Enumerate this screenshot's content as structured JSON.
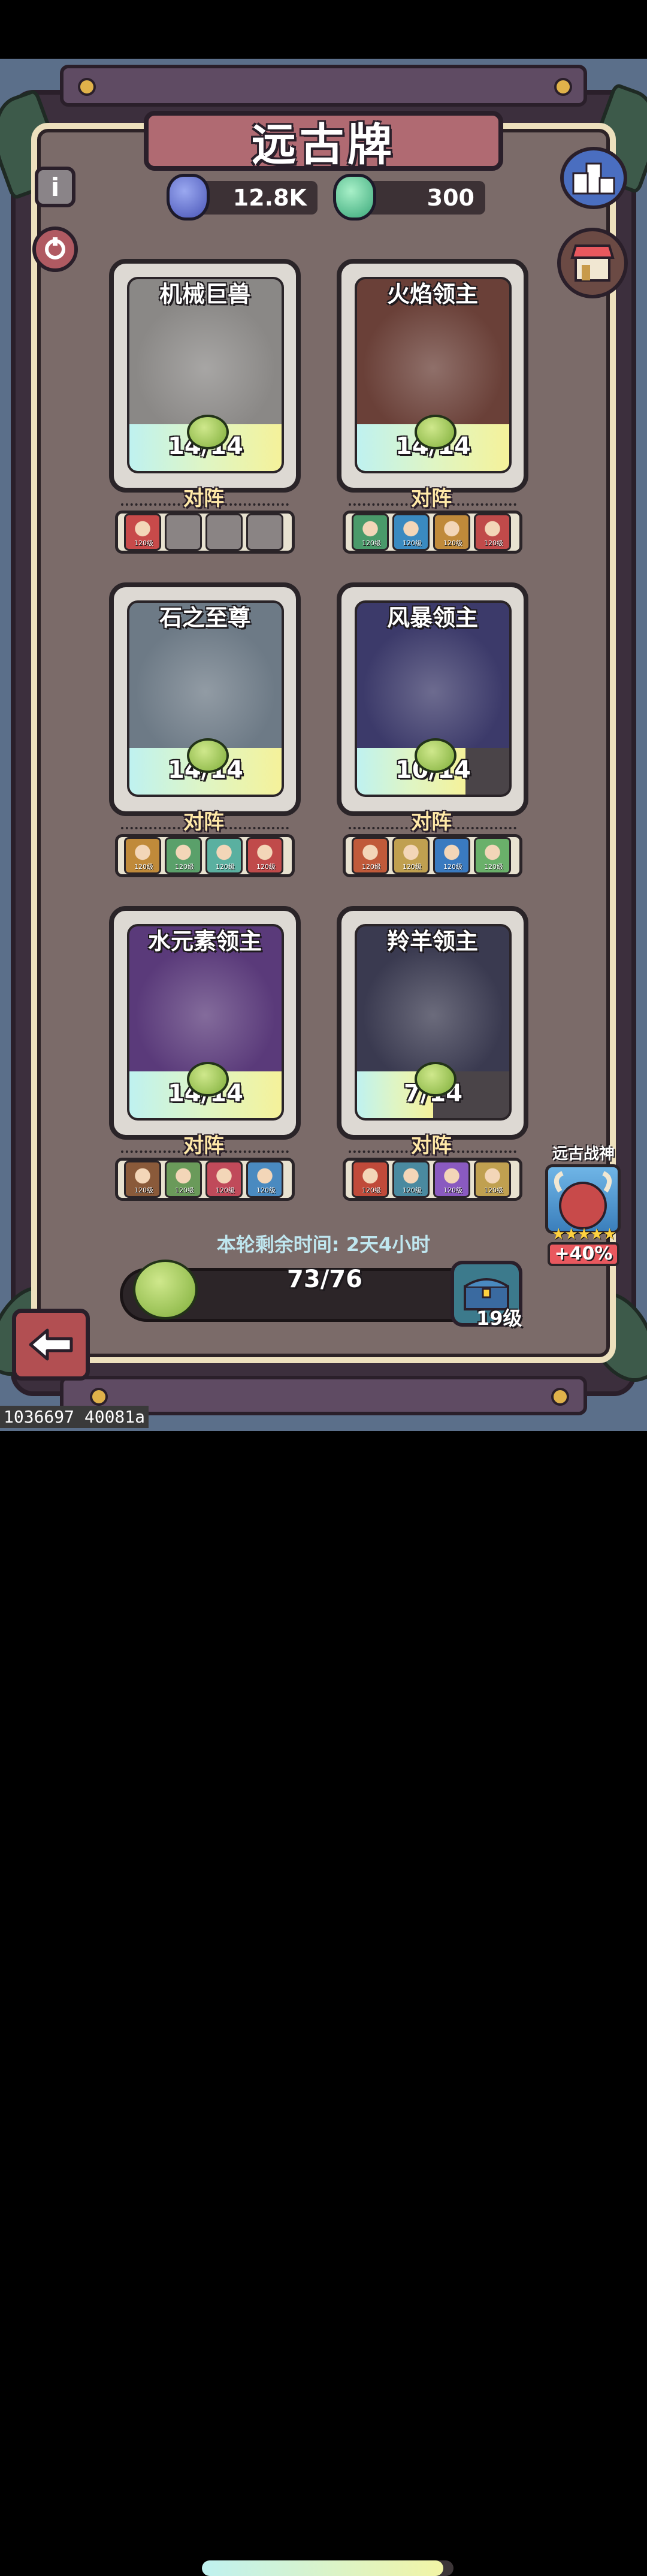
{
  "title": "远古牌",
  "resources": [
    {
      "icon": "blue-crystal-icon",
      "value": "12.8K"
    },
    {
      "icon": "green-crystal-icon",
      "value": "300"
    }
  ],
  "side_buttons": {
    "info": "i",
    "ranking_icon": "podium-icon",
    "shop_icon": "shop-icon",
    "history_icon": "refresh-icon"
  },
  "vs_label": "对阵",
  "cards": [
    {
      "name": "机械巨兽",
      "progress": "14/14",
      "filled": 14,
      "total": 14,
      "theme": "#8a8886",
      "opponents": [
        {
          "color": "#c84a4a",
          "level": "120级"
        },
        null,
        null,
        null
      ]
    },
    {
      "name": "火焰领主",
      "progress": "14/14",
      "filled": 14,
      "total": 14,
      "theme": "#6a4038",
      "opponents": [
        {
          "color": "#4a9a6a",
          "level": "120级"
        },
        {
          "color": "#3a8ac0",
          "level": "120级"
        },
        {
          "color": "#c08a3a",
          "level": "120级"
        },
        {
          "color": "#c04a4a",
          "level": "120级"
        }
      ]
    },
    {
      "name": "石之至尊",
      "progress": "14/14",
      "filled": 14,
      "total": 14,
      "theme": "#6d7a86",
      "opponents": [
        {
          "color": "#c08a3a",
          "level": "120级"
        },
        {
          "color": "#5aa06a",
          "level": "120级"
        },
        {
          "color": "#5ab0a0",
          "level": "120级"
        },
        {
          "color": "#c04a4a",
          "level": "120级"
        }
      ]
    },
    {
      "name": "风暴领主",
      "progress": "10/14",
      "filled": 10,
      "total": 14,
      "theme": "#3c3a6a",
      "opponents": [
        {
          "color": "#c05a3a",
          "level": "120级"
        },
        {
          "color": "#c0a050",
          "level": "120级"
        },
        {
          "color": "#3a7ac0",
          "level": "120级"
        },
        {
          "color": "#6ab06a",
          "level": "120级"
        }
      ]
    },
    {
      "name": "水元素领主",
      "progress": "14/14",
      "filled": 14,
      "total": 14,
      "theme": "#5a3a7a",
      "opponents": [
        {
          "color": "#8a5a3a",
          "level": "120级"
        },
        {
          "color": "#6a9a5a",
          "level": "120级"
        },
        {
          "color": "#c04a5a",
          "level": "120级"
        },
        {
          "color": "#4a8ac0",
          "level": "120级"
        }
      ]
    },
    {
      "name": "羚羊领主",
      "progress": "7/14",
      "filled": 7,
      "total": 14,
      "theme": "#3a3a50",
      "opponents": [
        {
          "color": "#c04a3a",
          "level": "120级"
        },
        {
          "color": "#4a8aa0",
          "level": "120级"
        },
        {
          "color": "#8a5ac0",
          "level": "120级"
        },
        {
          "color": "#c0a050",
          "level": "120级"
        }
      ]
    }
  ],
  "timer": {
    "label": "本轮剩余时间:",
    "value": "2天4小时"
  },
  "bar": {
    "text": "73/76",
    "current": 73,
    "total": 76,
    "level": "19级"
  },
  "war_god": {
    "title": "远古战神",
    "stars": "★★★★★",
    "bonus": "+40%"
  },
  "footer": "1036697 40081a"
}
